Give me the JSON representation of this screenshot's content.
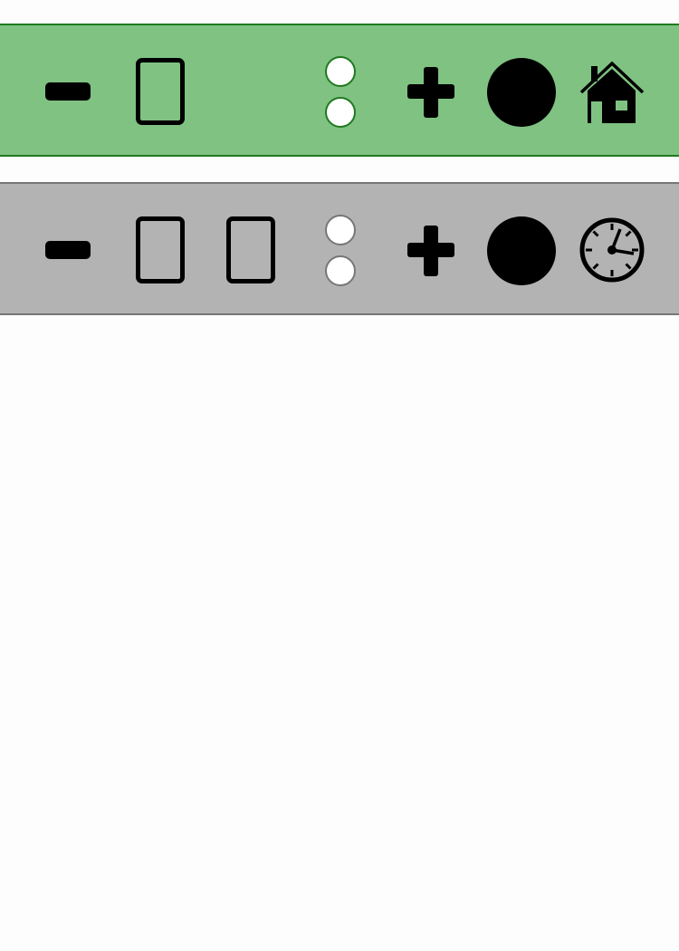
{
  "toolbars": [
    {
      "name": "primary-toolbar",
      "background": "#7fc282",
      "border": "#1e7a1e",
      "controls": [
        "minus-icon",
        "rectangle-button",
        "radio-dots",
        "plus-icon",
        "filled-circle-button",
        "home-icon"
      ]
    },
    {
      "name": "secondary-toolbar",
      "background": "#b3b3b3",
      "border": "#777777",
      "controls": [
        "minus-icon",
        "rectangle-button",
        "rectangle-button",
        "radio-dots",
        "plus-icon",
        "filled-circle-button",
        "clock-icon"
      ]
    }
  ],
  "colors": {
    "page_background": "#fdfdfd",
    "icon": "#000000",
    "dot_fill": "#ffffff"
  }
}
